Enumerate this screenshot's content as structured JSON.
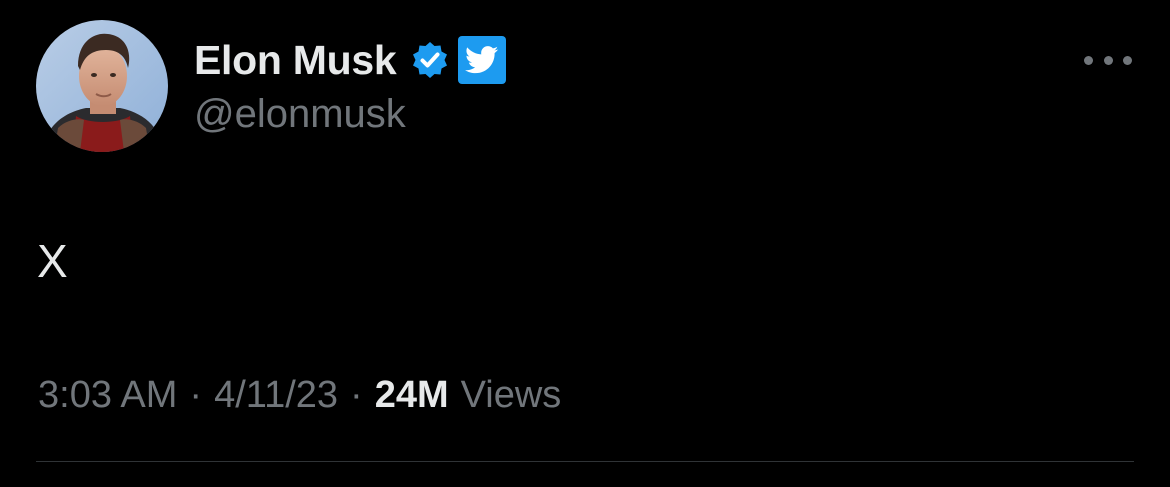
{
  "user": {
    "display_name": "Elon Musk",
    "handle": "@elonmusk",
    "verified": true
  },
  "tweet": {
    "text": "X",
    "time": "3:03 AM",
    "date": "4/11/23",
    "separator": "·",
    "views_count": "24M",
    "views_label": "Views"
  },
  "icons": {
    "avatar": "profile-photo",
    "verified": "verified-badge-icon",
    "twitter": "twitter-bird-icon",
    "more": "more-options-icon"
  },
  "colors": {
    "background": "#000000",
    "primary_text": "#e7e9ea",
    "secondary_text": "#71767b",
    "verified_blue": "#1d9bf0",
    "divider": "#2f3336"
  }
}
